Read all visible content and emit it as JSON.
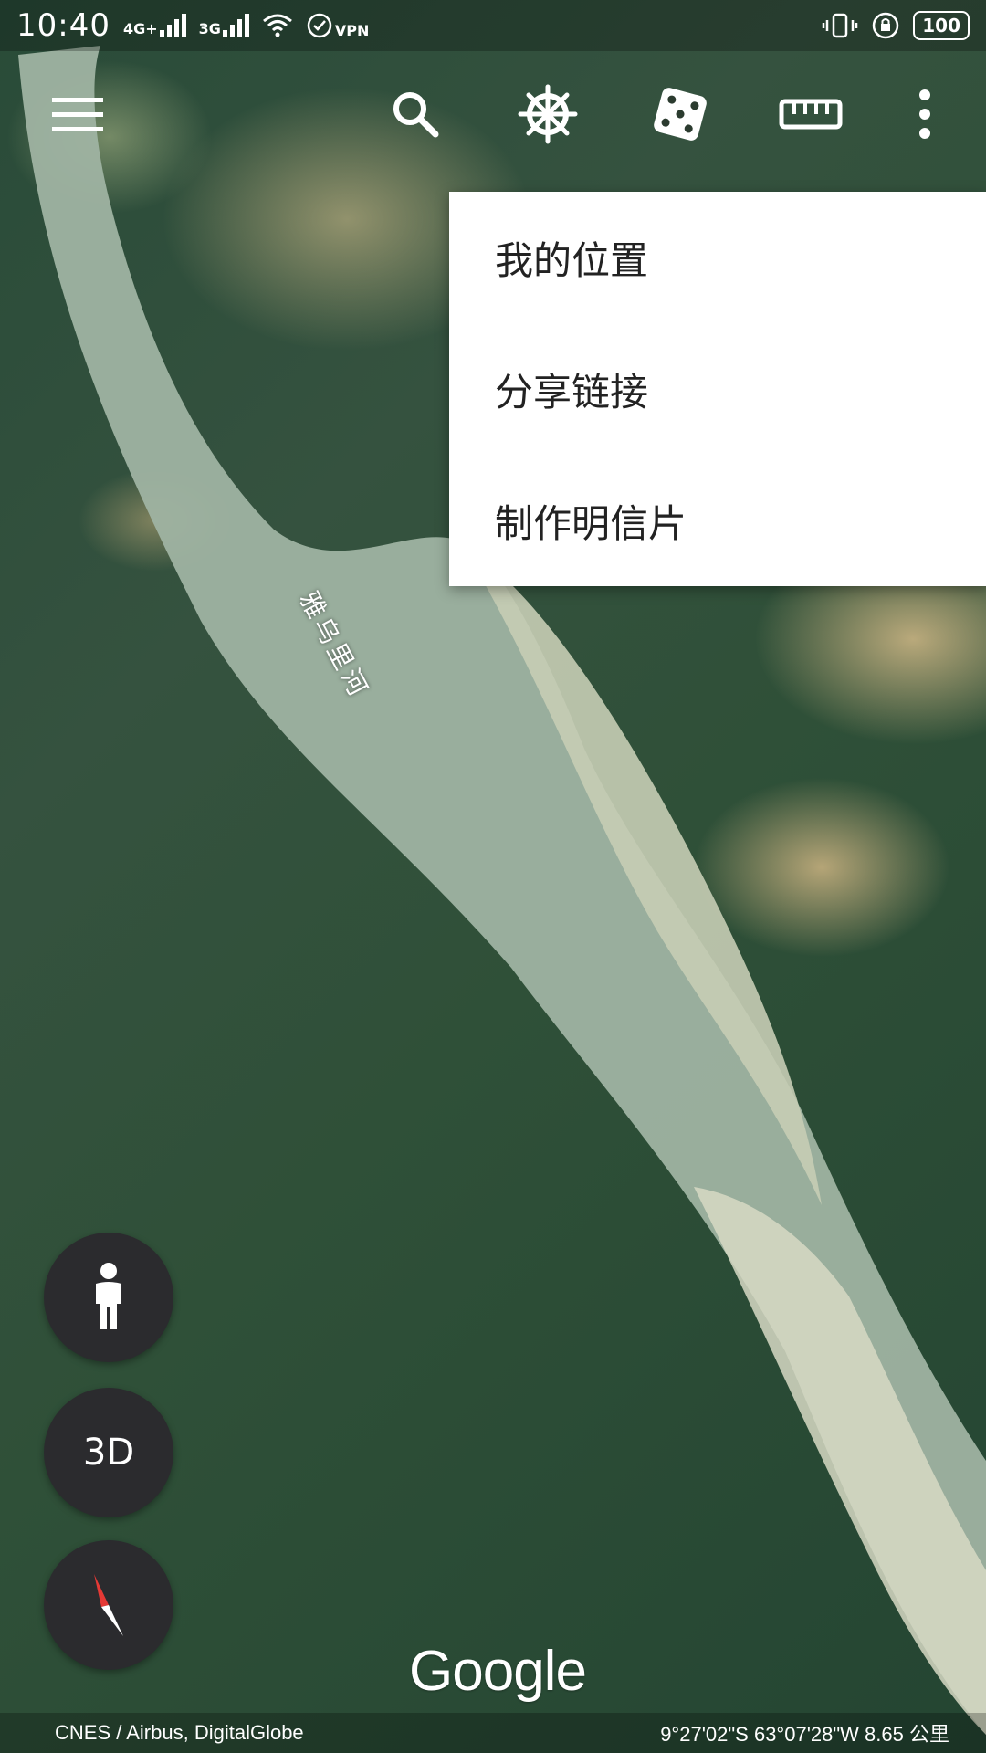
{
  "status_bar": {
    "time": "10:40",
    "net1": "4G+",
    "net2": "3G",
    "vpn": "VPN",
    "battery": "100"
  },
  "toolbar": {
    "icons": [
      "menu-icon",
      "search-icon",
      "voyager-wheel-icon",
      "dice-icon",
      "ruler-icon",
      "more-vert-icon"
    ]
  },
  "menu": {
    "items": [
      {
        "label": "我的位置"
      },
      {
        "label": "分享链接"
      },
      {
        "label": "制作明信片"
      }
    ]
  },
  "map": {
    "river_label": "雅乌里河"
  },
  "controls": {
    "street_view_icon": "person-icon",
    "three_d_label": "3D",
    "compass_icon": "compass-icon"
  },
  "branding": {
    "google": "Google"
  },
  "footer": {
    "attribution": "CNES / Airbus, DigitalGlobe",
    "coordinates": "9°27'02\"S 63°07'28\"W 8.65 公里"
  },
  "colors": {
    "fab_bg": "#2b2b2e",
    "compass_red": "#e53935"
  }
}
